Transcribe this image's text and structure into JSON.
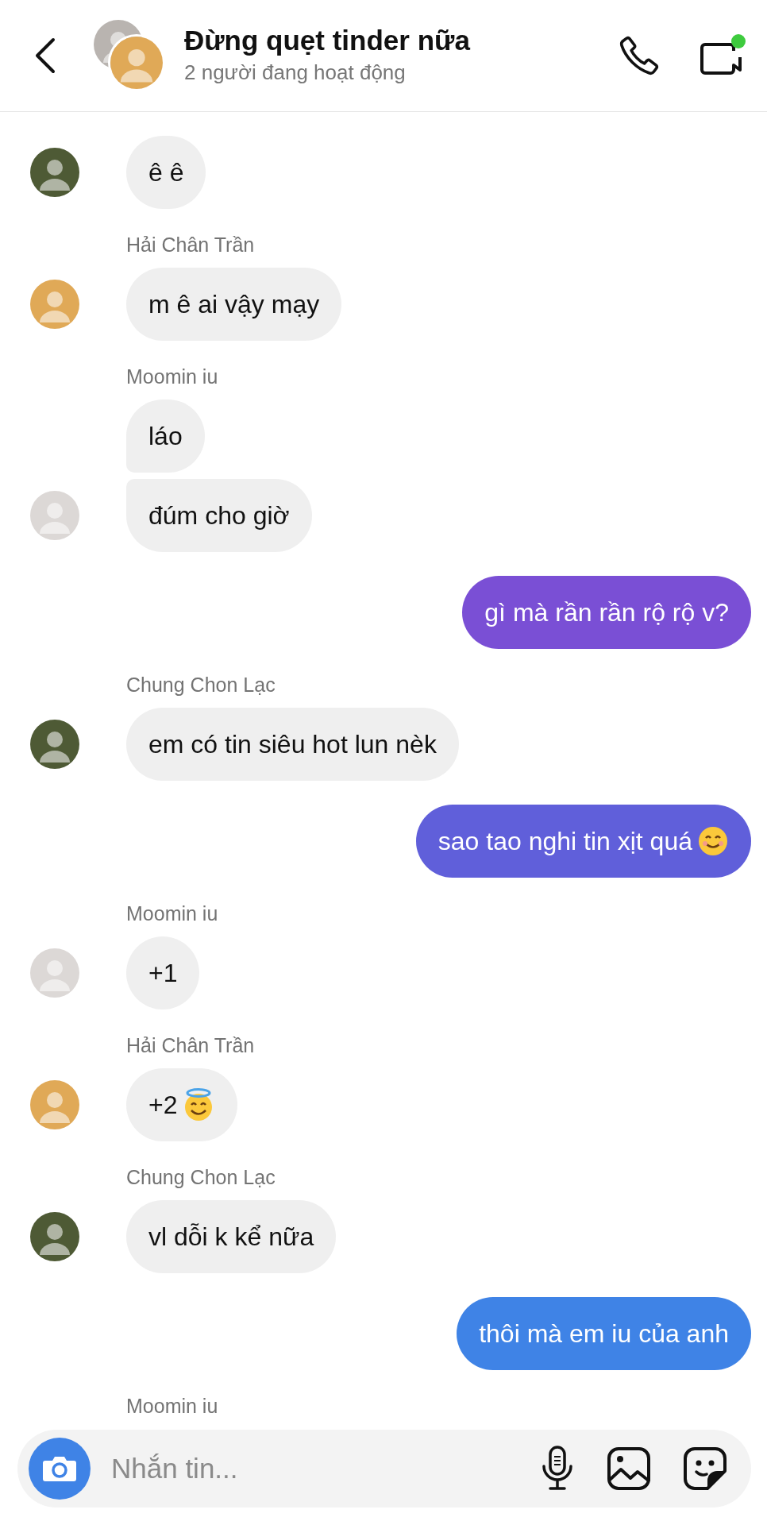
{
  "header": {
    "title": "Đừng quẹt tinder nữa",
    "subtitle": "2 người đang hoạt động",
    "online": true,
    "avatars": [
      {
        "color": "#b9b4b0"
      },
      {
        "color": "#e0a957"
      }
    ]
  },
  "messages": [
    {
      "kind": "incoming",
      "text": "ê ê",
      "avatar": {
        "color": "#4e5a35"
      }
    },
    {
      "kind": "sender",
      "text": "Hải Chân Trần"
    },
    {
      "kind": "incoming",
      "text": "m ê ai vậy mạy",
      "avatar": {
        "color": "#e0a957"
      }
    },
    {
      "kind": "sender",
      "text": "Moomin iu"
    },
    {
      "kind": "incoming",
      "text": "láo"
    },
    {
      "kind": "incoming",
      "text": "đúm cho giờ",
      "avatar": {
        "color": "#dcd8d6"
      }
    },
    {
      "kind": "outgoing",
      "text": "gì mà rần rần rộ rộ v?",
      "color": "#7a4fd5"
    },
    {
      "kind": "sender",
      "text": "Chung Chon Lạc"
    },
    {
      "kind": "incoming",
      "text": "em có tin siêu hot lun nèk",
      "avatar": {
        "color": "#4e5a35"
      }
    },
    {
      "kind": "outgoing",
      "text": "sao tao nghi tin xịt quá",
      "emoji": {
        "kind": "smile"
      },
      "color": "#605fda"
    },
    {
      "kind": "sender",
      "text": "Moomin iu"
    },
    {
      "kind": "incoming",
      "text": "+1",
      "avatar": {
        "color": "#dcd8d6"
      }
    },
    {
      "kind": "sender",
      "text": "Hải Chân Trần"
    },
    {
      "kind": "incoming",
      "text": "+2",
      "emoji": {
        "kind": "halo"
      },
      "avatar": {
        "color": "#e0a957"
      }
    },
    {
      "kind": "sender",
      "text": "Chung Chon Lạc"
    },
    {
      "kind": "incoming",
      "text": "vl dỗi k kể nữa",
      "avatar": {
        "color": "#4e5a35"
      }
    },
    {
      "kind": "outgoing",
      "text": "thôi mà em iu của anh",
      "color": "#3f83e6"
    },
    {
      "kind": "sender",
      "text": "Moomin iu"
    }
  ],
  "composer": {
    "placeholder": "Nhắn tin..."
  }
}
